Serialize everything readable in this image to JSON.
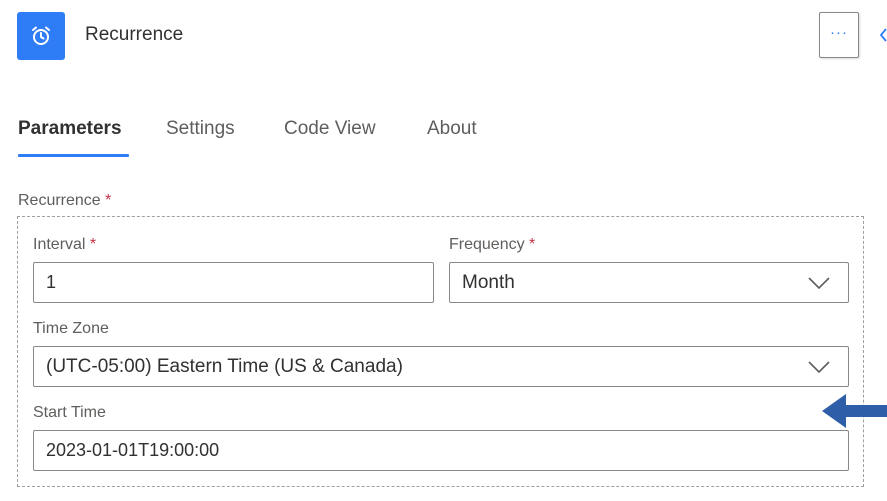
{
  "header": {
    "title": "Recurrence",
    "icon": "alarm-clock-icon",
    "more_label": "···",
    "accent": "#2f7df6"
  },
  "tabs": [
    {
      "label": "Parameters",
      "active": true
    },
    {
      "label": "Settings",
      "active": false
    },
    {
      "label": "Code View",
      "active": false
    },
    {
      "label": "About",
      "active": false
    }
  ],
  "recurrence": {
    "label": "Recurrence",
    "required_mark": "*",
    "interval": {
      "label": "Interval",
      "required_mark": "*",
      "value": "1"
    },
    "frequency": {
      "label": "Frequency",
      "required_mark": "*",
      "value": "Month"
    },
    "time_zone": {
      "label": "Time Zone",
      "value": "(UTC-05:00) Eastern Time (US & Canada)"
    },
    "start_time": {
      "label": "Start Time",
      "value": "2023-01-01T19:00:00"
    }
  }
}
